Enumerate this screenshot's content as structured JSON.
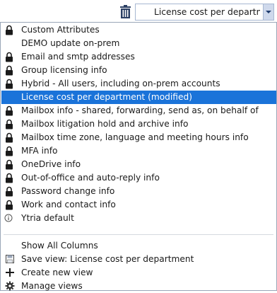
{
  "toolbar": {
    "trash_icon": "trash-icon",
    "view_selector_value": "License cost per departm"
  },
  "views": [
    {
      "label": "Custom Attributes",
      "icon": "lock-icon"
    },
    {
      "label": "DEMO update on-prem",
      "icon": ""
    },
    {
      "label": "Email and smtp addresses",
      "icon": "lock-icon"
    },
    {
      "label": "Group licensing info",
      "icon": "lock-icon"
    },
    {
      "label": "Hybrid - All users, including on-prem accounts",
      "icon": "lock-icon"
    },
    {
      "label": "License cost per department (modified)",
      "icon": "",
      "selected": true
    },
    {
      "label": "Mailbox info - shared, forwarding, send as, on behalf of",
      "icon": "lock-icon"
    },
    {
      "label": "Mailbox litigation hold and archive info",
      "icon": "lock-icon"
    },
    {
      "label": "Mailbox time zone, language and meeting hours info",
      "icon": "lock-icon"
    },
    {
      "label": "MFA info",
      "icon": "lock-icon"
    },
    {
      "label": "OneDrive info",
      "icon": "lock-icon"
    },
    {
      "label": "Out-of-office and auto-reply info",
      "icon": "lock-icon"
    },
    {
      "label": "Password change info",
      "icon": "lock-icon"
    },
    {
      "label": "Work and contact info",
      "icon": "lock-icon"
    },
    {
      "label": "Ytria default",
      "icon": "info-icon"
    }
  ],
  "actions": {
    "show_all_columns": "Show All Columns",
    "save_view": "Save view: License cost per department",
    "create_new_view": "Create new view",
    "manage_views": "Manage views"
  },
  "colors": {
    "selection": "#1a73d9",
    "combo_border": "#a7b7d1",
    "combo_button": "#cfd9ec"
  }
}
